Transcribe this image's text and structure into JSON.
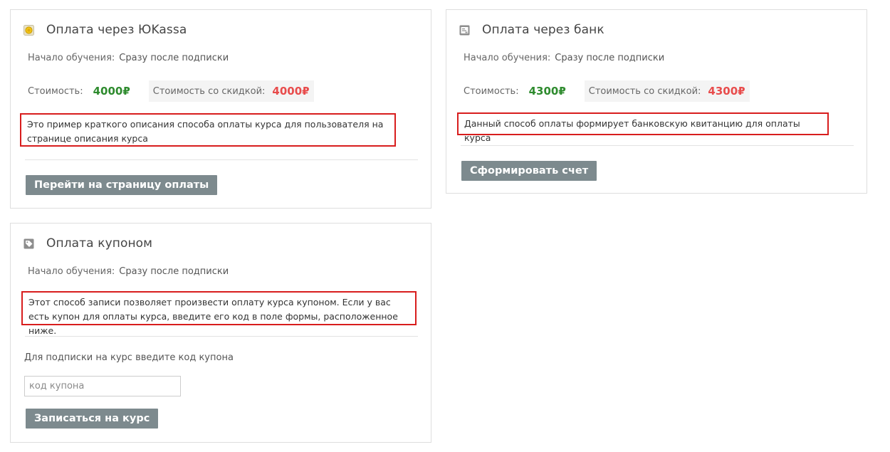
{
  "cards": {
    "yookassa": {
      "title": "Оплата через ЮKassa",
      "icon": "coin-icon",
      "start_label": "Начало обучения:",
      "start_value": "Сразу после подписки",
      "price_label": "Стоимость:",
      "price_value": "4000₽",
      "discount_label": "Стоимость со скидкой:",
      "discount_value": "4000₽",
      "description": "Это пример краткого описания способа оплаты курса для пользователя на странице описания курса",
      "button": "Перейти на страницу оплаты"
    },
    "bank": {
      "title": "Оплата через банк",
      "icon": "bank-receipt-icon",
      "start_label": "Начало обучения:",
      "start_value": "Сразу после подписки",
      "price_label": "Стоимость:",
      "price_value": "4300₽",
      "discount_label": "Стоимость со скидкой:",
      "discount_value": "4300₽",
      "description": "Данный способ оплаты формирует банковскую квитанцию для оплаты курса",
      "button": "Сформировать счет"
    },
    "coupon": {
      "title": "Оплата купоном",
      "icon": "tag-icon",
      "start_label": "Начало обучения:",
      "start_value": "Сразу после подписки",
      "description": "Этот способ записи позволяет произвести оплату курса купоном. Если у вас есть купон для оплаты курса, введите его код в поле формы, расположенное ниже.",
      "coupon_prompt": "Для подписки на курс введите код купона",
      "coupon_placeholder": "код купона",
      "coupon_value": "",
      "button": "Записаться на курс"
    }
  },
  "colors": {
    "price_green": "#2e8b2e",
    "price_red": "#e84c4c",
    "highlight_border": "#d81d1d",
    "button_bg": "#7d8a8e"
  }
}
